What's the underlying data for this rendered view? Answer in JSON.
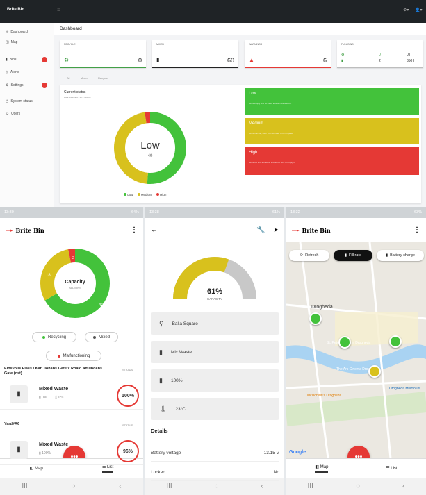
{
  "desktop": {
    "header": {
      "logo": "Brite Bin",
      "nav_glyph": "≡",
      "right_icons": [
        "⚙▾",
        "👤▾"
      ]
    },
    "sidebar": {
      "items": [
        {
          "label": "Dashboard",
          "icon": "dashboard-icon",
          "glyph": "◎"
        },
        {
          "label": "Map",
          "icon": "map-icon",
          "glyph": "◫"
        },
        {
          "label": "Bins",
          "icon": "bin-icon",
          "glyph": "▮",
          "badge": true
        },
        {
          "label": "Alerts",
          "icon": "alert-icon",
          "glyph": "◇"
        },
        {
          "label": "Settings",
          "icon": "gear-icon",
          "glyph": "⚙",
          "badge": true
        },
        {
          "label": "System status",
          "icon": "status-icon",
          "glyph": "◷"
        },
        {
          "label": "Users",
          "icon": "users-icon",
          "glyph": "☺"
        }
      ]
    },
    "page_title": "Dashboard",
    "cards": [
      {
        "title": "RECYCLE",
        "value": "0",
        "icon": "recycle-icon",
        "glyph": "♻",
        "color": "#43a047"
      },
      {
        "title": "MIXED",
        "value": "60",
        "icon": "bin-icon",
        "glyph": "▮",
        "color": "#222222"
      },
      {
        "title": "WARNINGS",
        "value": "6",
        "icon": "warning-icon",
        "glyph": "▲",
        "color": "#e53935"
      },
      {
        "title": "FULL BINS",
        "rows": [
          [
            "♻",
            "0",
            "0 l"
          ],
          [
            "▮",
            "2",
            "350 l"
          ]
        ],
        "color": "#bdbdbd"
      }
    ],
    "tabs": [
      "All",
      "Mixed",
      "Recycle"
    ],
    "status": {
      "title": "Current status",
      "subtitle": "Data refreshed - 10.17 10/30"
    },
    "donut": {
      "center_label": "Low",
      "center_value": "40",
      "low": 40,
      "medium": 36,
      "high": 2
    },
    "legend": [
      {
        "label": "Low",
        "color": "#43c23b"
      },
      {
        "label": "Medium",
        "color": "#d8c11d"
      },
      {
        "label": "High",
        "color": "#e53935"
      }
    ],
    "levels": [
      {
        "title": "Low",
        "desc": "Bin is empty and no need to take care about it",
        "color": "#43c23b"
      },
      {
        "title": "Medium",
        "desc": "Bin is half-full, soon you will need to be emptied",
        "color": "#d8c11d"
      },
      {
        "title": "High",
        "desc": "Bin is full and someone should be sent to empty it",
        "color": "#e53935"
      }
    ]
  },
  "phone1": {
    "status_time": "13:30",
    "status_right": "64%",
    "app_title": "Brite Bin",
    "donut": {
      "center_label": "Capacity",
      "center_sub": "ALL BINS",
      "recycling": 40,
      "mixed": 18,
      "malfunctioning": 2
    },
    "chips": [
      {
        "label": "Recycling",
        "color": "#43c23b"
      },
      {
        "label": "Mixed",
        "color": "#555555"
      },
      {
        "label": "Malfunctioning",
        "color": "#e53935"
      }
    ],
    "sections": [
      {
        "location": "Eidsvolls Plass / Karl Johans Gate x Roald Amundens Gate (ost)",
        "status_label": "STATUS",
        "bin_type": "Mixed Waste",
        "battery": "0%",
        "temp": "0°C",
        "percent": 100,
        "percent_label": "100%"
      },
      {
        "location": "Yard#A6",
        "status_label": "STATUS",
        "bin_type": "Mixed Waste",
        "battery": "100%",
        "temp": "",
        "percent": 96,
        "percent_label": "96%"
      }
    ],
    "tabs": [
      {
        "label": "Map",
        "icon": "map-icon"
      },
      {
        "label": "List",
        "icon": "list-icon"
      }
    ]
  },
  "phone2": {
    "status_time": "13:38",
    "status_right": "61%",
    "gauge": {
      "value": 61,
      "label": "61%",
      "caption": "CAPACITY"
    },
    "info": [
      {
        "icon": "location-pin-icon",
        "glyph": "⚲",
        "text": "Balla Square"
      },
      {
        "icon": "bin-icon",
        "glyph": "▮",
        "text": "Mix Waste"
      },
      {
        "icon": "battery-icon",
        "glyph": "▮",
        "text": "100%"
      },
      {
        "icon": "thermometer-icon",
        "glyph": "🌡",
        "text": "23°C"
      }
    ],
    "details_title": "Details",
    "details": [
      {
        "key": "Battery voltage",
        "value": "13.15 V"
      },
      {
        "key": "Locked",
        "value": "No"
      }
    ]
  },
  "phone3": {
    "status_time": "13:32",
    "status_right": "63%",
    "app_title": "Brite Bin",
    "buttons": [
      {
        "label": "Refresh",
        "icon": "refresh-icon",
        "glyph": "⟳"
      },
      {
        "label": "Fill rate",
        "icon": "bin-icon",
        "glyph": "▮"
      },
      {
        "label": "Battery charge",
        "icon": "battery-icon",
        "glyph": "▮"
      }
    ],
    "map_labels": [
      "Drogheda",
      "St. Peter's Parish, Drogheda",
      "The Arc Cinema Drogheda",
      "McDonald's Drogheda",
      "Drogheda Millmount",
      "Google"
    ],
    "tabs": [
      {
        "label": "Map",
        "icon": "map-icon"
      },
      {
        "label": "List",
        "icon": "list-icon"
      }
    ]
  },
  "android_nav": [
    "III",
    "○",
    "‹"
  ]
}
